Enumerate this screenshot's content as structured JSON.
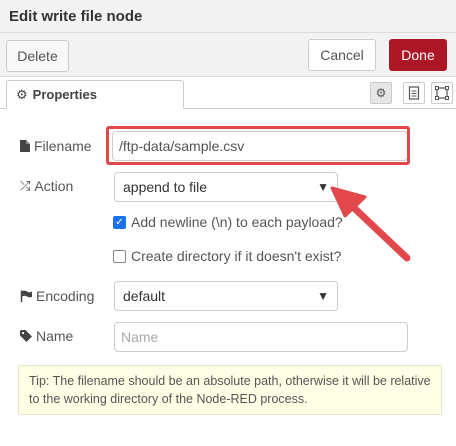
{
  "dialog": {
    "title": "Edit write file node",
    "delete_label": "Delete",
    "cancel_label": "Cancel",
    "done_label": "Done",
    "done_color": "#ad1625"
  },
  "tabs": {
    "properties_label": "Properties",
    "icons": [
      "gear-icon",
      "description-icon",
      "appearance-icon"
    ]
  },
  "form": {
    "filename_label": "Filename",
    "filename_value": "/ftp-data/sample.csv",
    "action_label": "Action",
    "action_value": "append to file",
    "add_newline_label": "Add newline (\\n) to each payload?",
    "add_newline_checked": true,
    "create_dir_label": "Create directory if it doesn't exist?",
    "create_dir_checked": false,
    "encoding_label": "Encoding",
    "encoding_value": "default",
    "name_label": "Name",
    "name_placeholder": "Name"
  },
  "tip": "Tip: The filename should be an absolute path, otherwise it will be relative to the working directory of the Node-RED process.",
  "annotation": {
    "highlight_color": "#e2474b",
    "arrow_color": "#e2474b"
  }
}
